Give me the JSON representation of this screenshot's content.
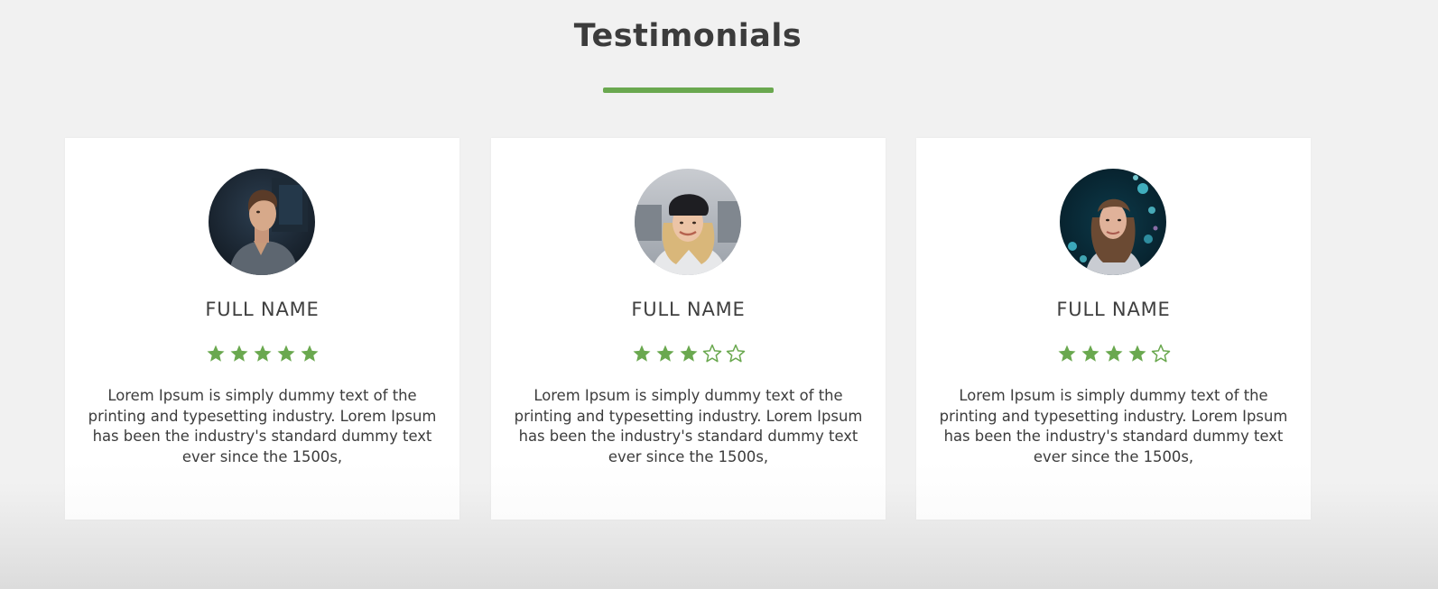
{
  "section": {
    "title": "Testimonials",
    "accent_color": "#6aa84f"
  },
  "testimonials": [
    {
      "name": "FULL NAME",
      "rating": 5,
      "rating_max": 5,
      "text": "Lorem Ipsum is simply dummy text of the printing and typesetting industry. Lorem Ipsum has been the industry's standard dummy text ever since the 1500s,",
      "avatar": "photo-man-icon"
    },
    {
      "name": "FULL NAME",
      "rating": 3,
      "rating_max": 5,
      "text": "Lorem Ipsum is simply dummy text of the printing and typesetting industry. Lorem Ipsum has been the industry's standard dummy text ever since the 1500s,",
      "avatar": "photo-woman-beanie-icon"
    },
    {
      "name": "FULL NAME",
      "rating": 4,
      "rating_max": 5,
      "text": "Lorem Ipsum is simply dummy text of the printing and typesetting industry. Lorem Ipsum has been the industry's standard dummy text ever since the 1500s,",
      "avatar": "photo-woman-lights-icon"
    }
  ]
}
